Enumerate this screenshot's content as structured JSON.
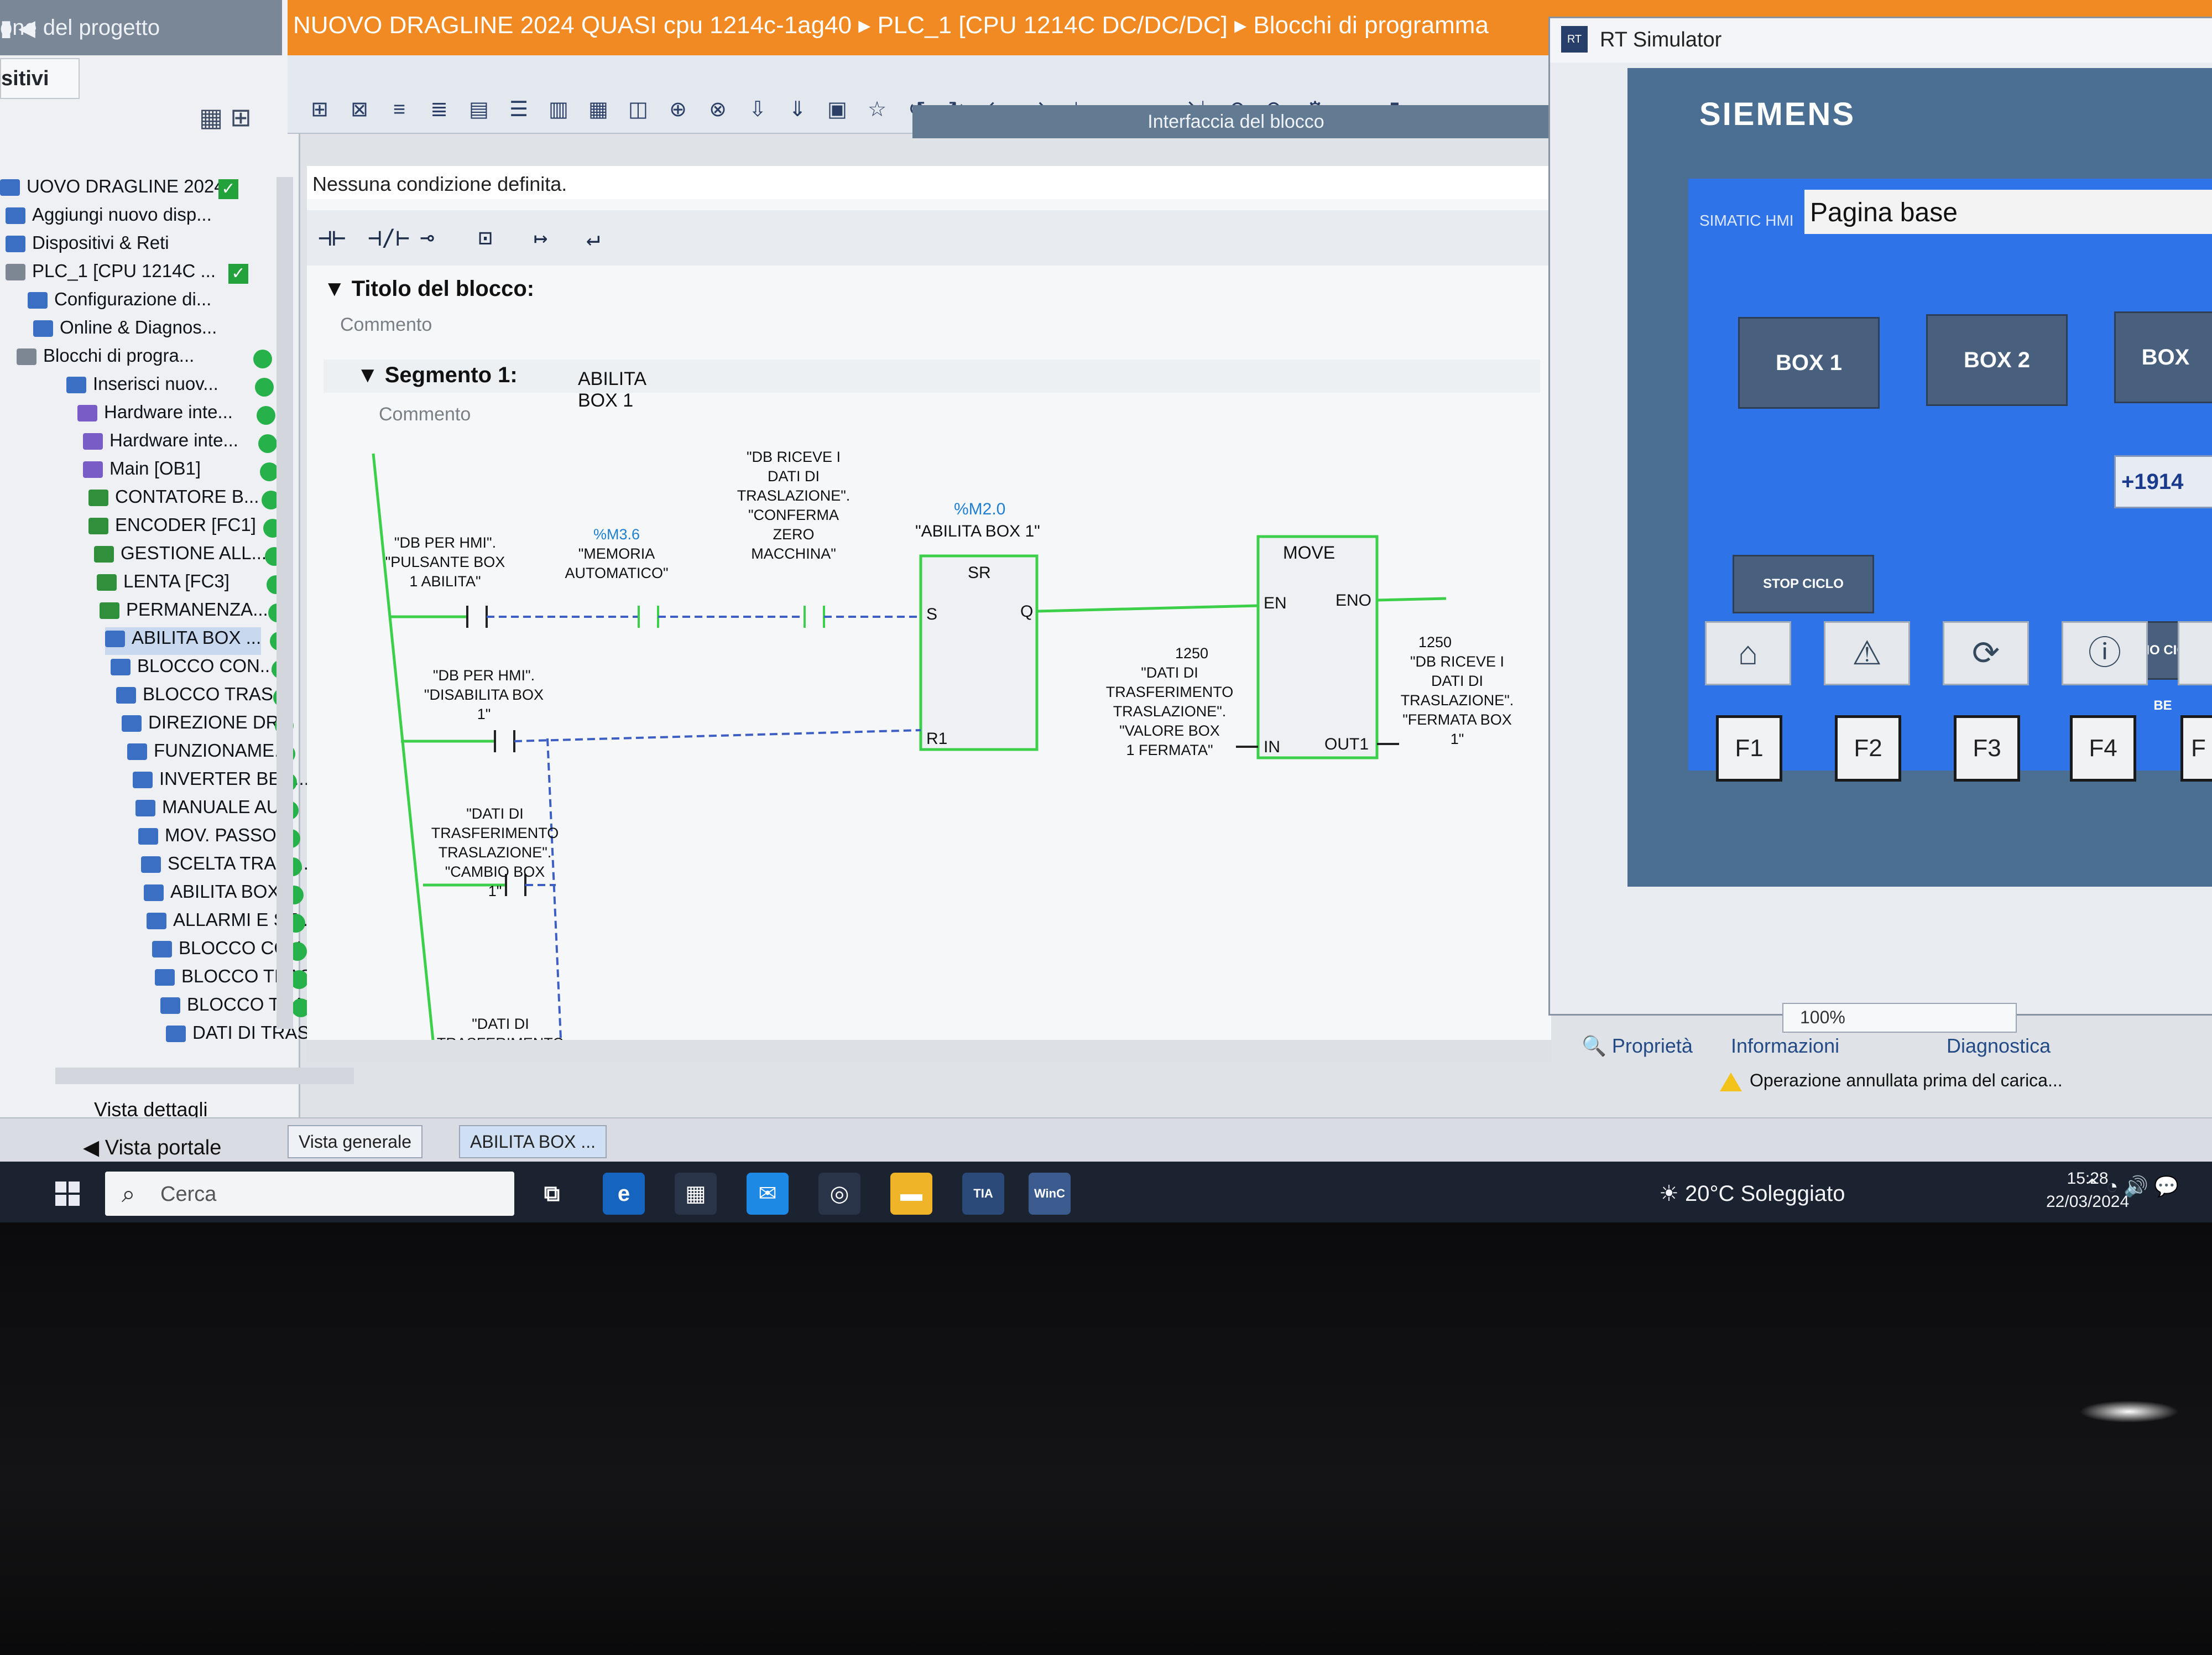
{
  "project_tree": {
    "header": "one del progetto",
    "tab": "sitivi",
    "items": [
      {
        "label": "UOVO DRAGLINE 2024...",
        "icon": "project-icon"
      },
      {
        "label": "Aggiungi nuovo disp...",
        "icon": "add-device-icon"
      },
      {
        "label": "Dispositivi & Reti",
        "icon": "network-icon"
      },
      {
        "label": "PLC_1 [CPU 1214C ...",
        "icon": "plc-icon"
      },
      {
        "label": "Configurazione di...",
        "icon": "config-icon"
      },
      {
        "label": "Online & Diagnos...",
        "icon": "diagnostics-icon"
      },
      {
        "label": "Blocchi di progra...",
        "icon": "folder-icon"
      },
      {
        "label": "Inserisci nuov...",
        "icon": "add-block-icon"
      },
      {
        "label": "Hardware inte...",
        "icon": "ob-icon"
      },
      {
        "label": "Hardware inte...",
        "icon": "ob-icon"
      },
      {
        "label": "Main [OB1]",
        "icon": "ob-icon"
      },
      {
        "label": "CONTATORE B...",
        "icon": "fc-icon"
      },
      {
        "label": "ENCODER [FC1]",
        "icon": "fc-icon"
      },
      {
        "label": "GESTIONE ALL...",
        "icon": "fc-icon"
      },
      {
        "label": "LENTA [FC3]",
        "icon": "fc-icon"
      },
      {
        "label": "PERMANENZA...",
        "icon": "fc-icon"
      },
      {
        "label": "ABILITA BOX ...",
        "icon": "fb-icon"
      },
      {
        "label": "BLOCCO CON...",
        "icon": "fb-icon"
      },
      {
        "label": "BLOCCO TRAS...",
        "icon": "fb-icon"
      },
      {
        "label": "DIREZIONE DR...",
        "icon": "fb-icon"
      },
      {
        "label": "FUNZIONAME...",
        "icon": "fb-icon"
      },
      {
        "label": "INVERTER BEN...",
        "icon": "fb-icon"
      },
      {
        "label": "MANUALE AU...",
        "icon": "fb-icon"
      },
      {
        "label": "MOV. PASSO ...",
        "icon": "fb-icon"
      },
      {
        "label": "SCELTA TRASL...",
        "icon": "fb-icon"
      },
      {
        "label": "ABILITA BOX ...",
        "icon": "db-icon"
      },
      {
        "label": "ALLARMI E SE...",
        "icon": "db-icon"
      },
      {
        "label": "BLOCCO CON...",
        "icon": "db-icon"
      },
      {
        "label": "BLOCCO TRAS...",
        "icon": "db-icon"
      },
      {
        "label": "BLOCCO TRAS...",
        "icon": "db-icon"
      },
      {
        "label": "DATI DI TRASF...",
        "icon": "db-icon"
      }
    ],
    "vista_dettagli": "Vista dettagli"
  },
  "editor": {
    "title_path": "NUOVO DRAGLINE 2024 QUASI cpu 1214c-1ag40  ▸  PLC_1 [CPU 1214C DC/DC/DC]  ▸  Blocchi di programma",
    "interface_label": "Interfaccia del blocco",
    "condition_text": "Nessuna condizione definita.",
    "block_title_label": "Titolo del blocco:",
    "comment_label": "Commento",
    "segment_label": "Segmento 1:",
    "segment_name": "ABILITA BOX 1",
    "segment_comment": "Commento"
  },
  "ladder": {
    "contact1": {
      "line1": "\"DB PER HMI\".",
      "line2": "\"PULSANTE BOX",
      "line3": "1 ABILITA\""
    },
    "contact2": {
      "address": "%M3.6",
      "line1": "\"MEMORIA",
      "line2": "AUTOMATICO\""
    },
    "contact3": {
      "line1": "\"DB RICEVE I",
      "line2": "DATI DI",
      "line3": "TRASLAZIONE\".",
      "line4": "\"CONFERMA",
      "line5": "ZERO",
      "line6": "MACCHINA\""
    },
    "sr": {
      "address": "%M2.0",
      "name": "\"ABILITA BOX 1\"",
      "title": "SR",
      "s": "S",
      "q": "Q",
      "r1": "R1"
    },
    "contact4": {
      "line1": "\"DB PER HMI\".",
      "line2": "\"DISABILITA BOX",
      "line3": "1\""
    },
    "contact5": {
      "line1": "\"DATI DI",
      "line2": "TRASFERIMENTO",
      "line3": "TRASLAZIONE\".",
      "line4": "\"CAMBIO BOX",
      "line5": "1\""
    },
    "contact6": {
      "line1": "\"DATI DI",
      "line2": "TRASFERIMENTO"
    },
    "move": {
      "title": "MOVE",
      "en": "EN",
      "eno": "ENO",
      "in": "IN",
      "out": "OUT1"
    },
    "move_in": {
      "value": "1250",
      "line1": "\"DATI DI",
      "line2": "TRASFERIMENTO",
      "line3": "TRASLAZIONE\".",
      "line4": "\"VALORE BOX",
      "line5": "1 FERMATA\""
    },
    "move_out": {
      "value": "1250",
      "line1": "\"DB RICEVE I",
      "line2": "DATI DI",
      "line3": "TRASLAZIONE\".",
      "line4": "\"FERMATA BOX",
      "line5": "1\""
    }
  },
  "rt_simulator": {
    "title": "RT Simulator",
    "brand": "SIEMENS",
    "simatic": "SIMATIC HMI",
    "page_name": "Pagina base",
    "buttons": {
      "box1": "BOX 1",
      "box2": "BOX 2",
      "box3": "BOX",
      "stop": "STOP CICLO",
      "inizio": "INIZIO CICLO BE"
    },
    "value_display": "+1914",
    "fkeys": [
      "F1",
      "F2",
      "F3",
      "F4",
      "F"
    ],
    "zoom": "100%"
  },
  "bottom": {
    "vista_portale": "Vista portale",
    "tabs": [
      "Vista generale",
      "ABILITA BOX ..."
    ],
    "info_tabs": {
      "proprieta": "Proprietà",
      "informazioni": "Informazioni",
      "diagnostica": "Diagnostica"
    },
    "status_message": "Operazione annullata prima del carica..."
  },
  "taskbar": {
    "search_placeholder": "Cerca",
    "apps": [
      {
        "name": "task-view",
        "label": "⧉"
      },
      {
        "name": "edge",
        "label": "e"
      },
      {
        "name": "store",
        "label": "▦"
      },
      {
        "name": "mail",
        "label": "✉"
      },
      {
        "name": "chrome",
        "label": "◎"
      },
      {
        "name": "explorer",
        "label": "▬"
      },
      {
        "name": "tia",
        "label": "TIA V16"
      },
      {
        "name": "wincc-rt",
        "label": "WinC RT"
      }
    ],
    "weather": "20°C  Soleggiato",
    "time": "15:28",
    "date": "22/03/2024"
  },
  "colors": {
    "accent_orange": "#f28a24",
    "hmi_blue": "#2e73e8",
    "power_flow": "#3ccf4a",
    "status_ok": "#27b14a"
  }
}
